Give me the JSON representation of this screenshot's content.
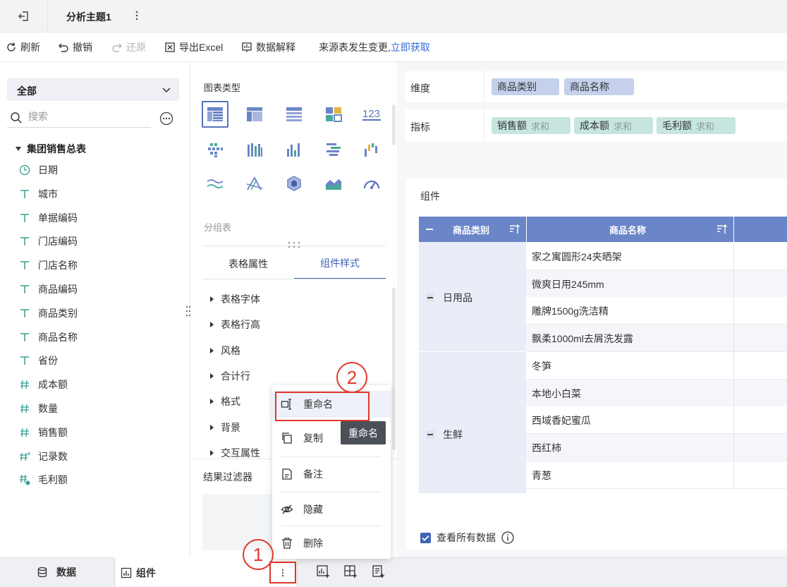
{
  "app": {
    "title": "分析主题1"
  },
  "toolbar": {
    "refresh": "刷新",
    "undo": "撤销",
    "redo": "还原",
    "export": "导出Excel",
    "explain": "数据解释",
    "notice": "来源表发生变更,",
    "notice_link": "立即获取"
  },
  "left": {
    "dataset_select": "全部",
    "search_placeholder": "搜索",
    "table_name": "集团销售总表",
    "fields": [
      {
        "label": "日期",
        "icon": "clock-icon"
      },
      {
        "label": "城市",
        "icon": "text-type-icon"
      },
      {
        "label": "单据编码",
        "icon": "text-type-icon"
      },
      {
        "label": "门店编码",
        "icon": "text-type-icon"
      },
      {
        "label": "门店名称",
        "icon": "text-type-icon"
      },
      {
        "label": "商品编码",
        "icon": "text-type-icon"
      },
      {
        "label": "商品类别",
        "icon": "text-type-icon"
      },
      {
        "label": "商品名称",
        "icon": "text-type-icon"
      },
      {
        "label": "省份",
        "icon": "text-type-icon"
      },
      {
        "label": "成本额",
        "icon": "number-type-icon"
      },
      {
        "label": "数量",
        "icon": "number-type-icon"
      },
      {
        "label": "销售额",
        "icon": "number-type-icon"
      },
      {
        "label": "记录数",
        "icon": "count-type-icon"
      },
      {
        "label": "毛利额",
        "icon": "calc-number-icon"
      }
    ]
  },
  "middle": {
    "chart_type_title": "图表类型",
    "chart_types": [
      "group-table-icon",
      "cross-table-icon",
      "detail-table-icon",
      "kpi-grid-icon",
      "number-123-icon",
      "dot-chart-icon",
      "multi-bar-icon",
      "bar-chart-icon",
      "horizontal-bar-icon",
      "waterfall-icon",
      "line-chart-icon",
      "radar-icon",
      "polygon-icon",
      "area-chart-icon",
      "gauge-icon"
    ],
    "selected_chart": "分组表",
    "tabs": [
      "表格属性",
      "组件样式"
    ],
    "active_tab": "组件样式",
    "sections": [
      "表格字体",
      "表格行高",
      "风格",
      "合计行",
      "格式",
      "背景",
      "交互属性"
    ],
    "filter_title": "结果过滤器"
  },
  "right": {
    "dimension_label": "维度",
    "dimensions": [
      "商品类别",
      "商品名称"
    ],
    "measure_label": "指标",
    "measures": [
      {
        "name": "销售额",
        "agg": "求和"
      },
      {
        "name": "成本额",
        "agg": "求和"
      },
      {
        "name": "毛利额",
        "agg": "求和"
      }
    ],
    "widget_title": "组件",
    "table": {
      "headers": [
        "商品类别",
        "商品名称"
      ],
      "groups": [
        {
          "category": "日用品",
          "items": [
            "家之寓圆形24夹晒架",
            "微爽日用245mm",
            "雕牌1500g洗洁精",
            "飘柔1000ml去屑洗发露"
          ]
        },
        {
          "category": "生鲜",
          "items": [
            "冬笋",
            "本地小白菜",
            "西域香妃蜜瓜",
            "西红柿",
            "青葱"
          ]
        }
      ]
    },
    "view_all": "查看所有数据"
  },
  "bottom": {
    "data_tab": "数据",
    "component_tab": "组件"
  },
  "context_menu": {
    "items": [
      "重命名",
      "复制",
      "备注",
      "隐藏",
      "删除"
    ],
    "tooltip": "重命名"
  },
  "annotations": {
    "badge1": "1",
    "badge2": "2"
  },
  "colors": {
    "accent": "#3f64b5",
    "header": "#6a85c8",
    "highlight": "#e0372b",
    "dim_pill": "#c5d0ec",
    "measure_pill": "#c6e5df"
  }
}
